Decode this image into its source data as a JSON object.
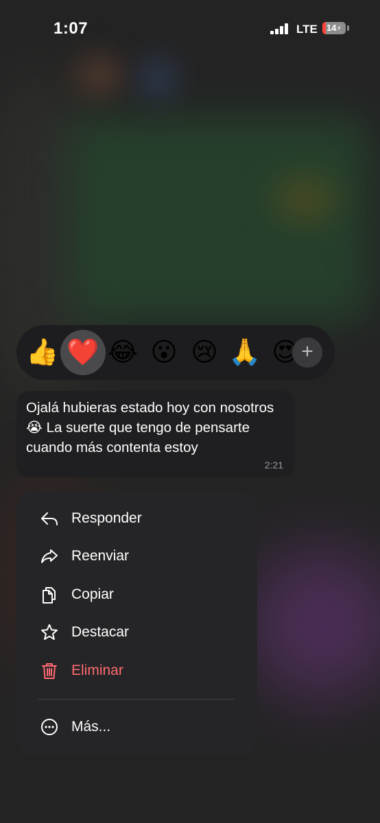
{
  "status_bar": {
    "time": "1:07",
    "network": "LTE",
    "battery_level": "14",
    "charging": true
  },
  "reactions": {
    "items": [
      {
        "name": "thumbs-up",
        "emoji": "👍",
        "selected": false
      },
      {
        "name": "red-heart",
        "emoji": "❤️",
        "selected": true
      },
      {
        "name": "tears-of-joy",
        "emoji": "😂",
        "selected": false
      },
      {
        "name": "open-mouth",
        "emoji": "😮",
        "selected": false
      },
      {
        "name": "crying",
        "emoji": "😢",
        "selected": false
      },
      {
        "name": "folded-hands",
        "emoji": "🙏",
        "selected": false
      },
      {
        "name": "heart-eyes",
        "emoji": "😍",
        "selected": false
      }
    ],
    "more_label": "+"
  },
  "message": {
    "text": "Ojalá hubieras estado hoy con nosotros 😭 La suerte que tengo de pensarte cuando más contenta estoy",
    "time": "2:21"
  },
  "menu": {
    "reply": "Responder",
    "forward": "Reenviar",
    "copy": "Copiar",
    "star": "Destacar",
    "delete": "Eliminar",
    "more": "Más..."
  },
  "colors": {
    "danger": "#ff6b70",
    "menu_bg": "#252527",
    "bubble_bg": "#1f1f21"
  }
}
